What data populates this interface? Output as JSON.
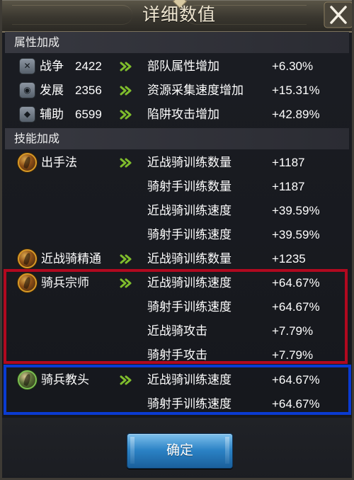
{
  "dialog": {
    "title": "详细数值",
    "confirm_label": "确定",
    "close_icon": "close-icon"
  },
  "attributes": {
    "header": "属性加成",
    "rows": [
      {
        "name": "战争",
        "value": "2422",
        "effect": "部队属性增加",
        "bonus": "+6.30%",
        "icon": "war-icon"
      },
      {
        "name": "发展",
        "value": "2356",
        "effect": "资源采集速度增加",
        "bonus": "+15.31%",
        "icon": "development-icon"
      },
      {
        "name": "辅助",
        "value": "6599",
        "effect": "陷阱攻击增加",
        "bonus": "+42.89%",
        "icon": "support-icon"
      }
    ]
  },
  "skills": {
    "header": "技能加成",
    "items": [
      {
        "name": "出手法",
        "effect": "近战骑训练数量",
        "bonus": "+1187",
        "icon": "skill-icon"
      },
      {
        "name": "",
        "effect": "骑射手训练数量",
        "bonus": "+1187"
      },
      {
        "name": "",
        "effect": "近战骑训练速度",
        "bonus": "+39.59%"
      },
      {
        "name": "",
        "effect": "骑射手训练速度",
        "bonus": "+39.59%"
      },
      {
        "name": "近战骑精通",
        "effect": "近战骑训练数量",
        "bonus": "+1235",
        "icon": "skill-icon"
      },
      {
        "name": "骑兵宗师",
        "effect": "近战骑训练速度",
        "bonus": "+64.67%",
        "icon": "skill-icon"
      },
      {
        "name": "",
        "effect": "骑射手训练速度",
        "bonus": "+64.67%"
      },
      {
        "name": "",
        "effect": "近战骑攻击",
        "bonus": "+7.79%"
      },
      {
        "name": "",
        "effect": "骑射手攻击",
        "bonus": "+7.79%"
      },
      {
        "name": "骑兵教头",
        "effect": "近战骑训练速度",
        "bonus": "+64.67%",
        "icon": "skill-icon"
      },
      {
        "name": "",
        "effect": "骑射手训练速度",
        "bonus": "+64.67%"
      }
    ]
  },
  "colors": {
    "highlight_red": "#b1091f",
    "highlight_blue": "#0a3bd2",
    "arrow_green": "#7fbd2c",
    "button_blue": "#2b82c5"
  }
}
